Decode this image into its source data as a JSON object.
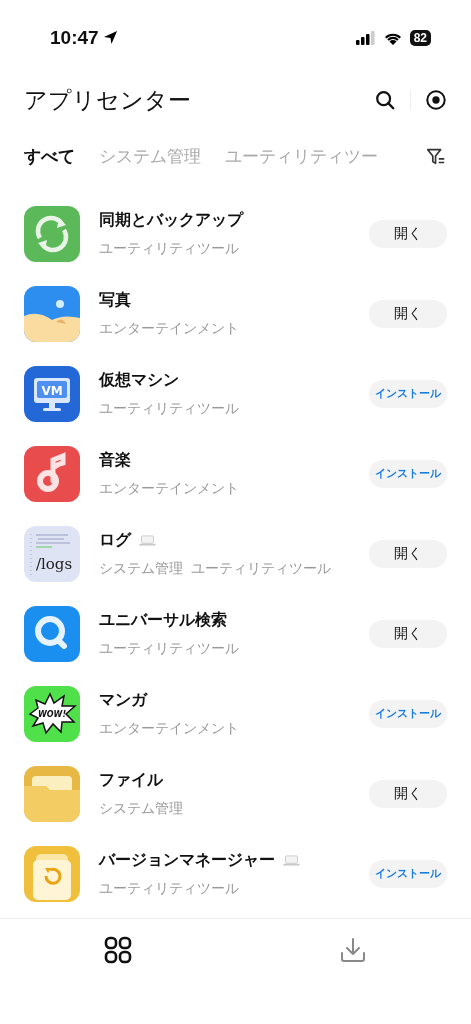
{
  "status_bar": {
    "time": "10:47",
    "battery": "82"
  },
  "header": {
    "title": "アプリセンター"
  },
  "tabs": [
    {
      "label": "すべて",
      "selected": true
    },
    {
      "label": "システム管理",
      "selected": false
    },
    {
      "label": "ユーティリティツー",
      "selected": false
    }
  ],
  "apps": [
    {
      "name": "同期とバックアップ",
      "desktop_only": false,
      "categories": [
        "ユーティリティツール"
      ],
      "action": {
        "kind": "open",
        "label": "開く"
      }
    },
    {
      "name": "写真",
      "desktop_only": false,
      "categories": [
        "エンターテインメント"
      ],
      "action": {
        "kind": "open",
        "label": "開く"
      }
    },
    {
      "icon_label": "VM",
      "name": "仮想マシン",
      "desktop_only": false,
      "categories": [
        "ユーティリティツール"
      ],
      "action": {
        "kind": "install",
        "label": "インストール"
      }
    },
    {
      "name": "音楽",
      "desktop_only": false,
      "categories": [
        "エンターテインメント"
      ],
      "action": {
        "kind": "install",
        "label": "インストール"
      }
    },
    {
      "icon_label": "/logs",
      "name": "ログ",
      "desktop_only": true,
      "categories": [
        "システム管理",
        "ユーティリティツール"
      ],
      "action": {
        "kind": "open",
        "label": "開く"
      }
    },
    {
      "name": "ユニバーサル検索",
      "desktop_only": false,
      "categories": [
        "ユーティリティツール"
      ],
      "action": {
        "kind": "open",
        "label": "開く"
      }
    },
    {
      "icon_label": "WOW!",
      "name": "マンガ",
      "desktop_only": false,
      "categories": [
        "エンターテインメント"
      ],
      "action": {
        "kind": "install",
        "label": "インストール"
      }
    },
    {
      "name": "ファイル",
      "desktop_only": false,
      "categories": [
        "システム管理"
      ],
      "action": {
        "kind": "open",
        "label": "開く"
      }
    },
    {
      "name": "バージョンマネージャー",
      "desktop_only": true,
      "categories": [
        "ユーティリティツール"
      ],
      "action": {
        "kind": "install",
        "label": "インストール"
      }
    }
  ],
  "tab_bar": [
    {
      "kind": "apps",
      "selected": true
    },
    {
      "kind": "downloads",
      "selected": false
    }
  ]
}
